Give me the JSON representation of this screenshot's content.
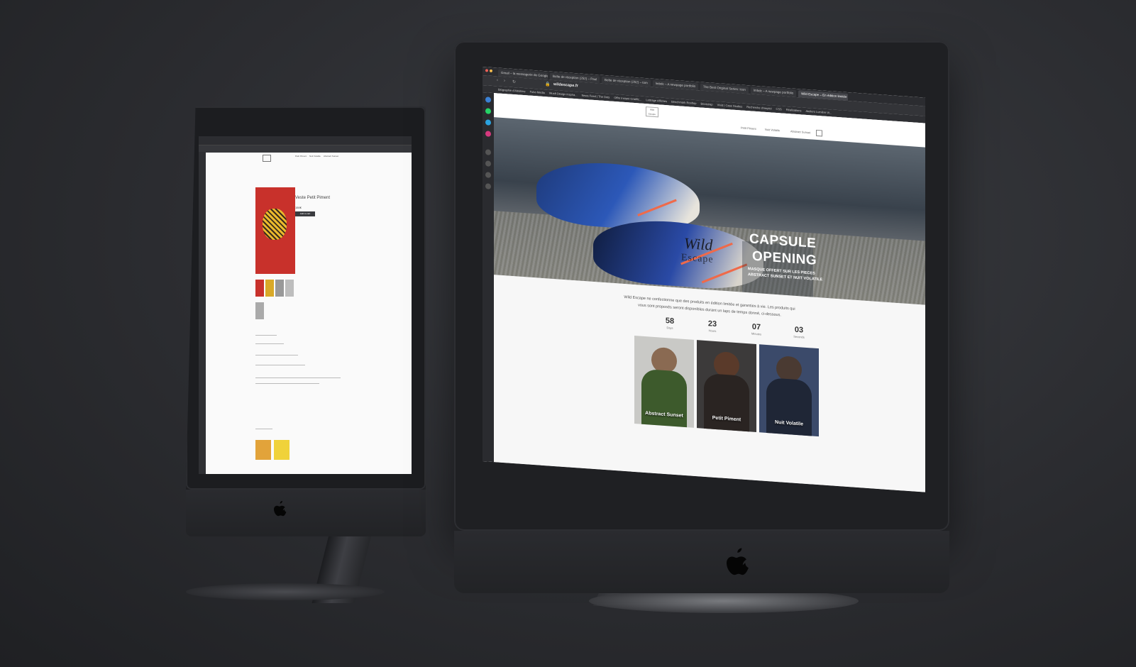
{
  "browser": {
    "tabs": [
      {
        "label": "Gmail – la messagerie de Google",
        "active": false
      },
      {
        "label": "Boîte de réception (252) – Paul",
        "active": false
      },
      {
        "label": "Boîte de réception (252) – tom",
        "active": false
      },
      {
        "label": "lmbdc – A newpage portfolio",
        "active": false
      },
      {
        "label": "The Best Original Series: Icon",
        "active": false
      },
      {
        "label": "lmbdc – A newpage portfolio",
        "active": false
      },
      {
        "label": "Wild Escape – En édition limitée",
        "active": true
      }
    ],
    "url": "wildescape.fr",
    "bookmarks": [
      "Biographie d'Alekhine",
      "Fubo Media",
      "Wusft Design inspira...",
      "News Feed | The Dots",
      "Offre Instant Gratific...",
      "Lettrage Affiches",
      "Benchmark Rooftop",
      "Bootstrap",
      "Vivid | Case Studies",
      "Recherche d'emploi",
      "CSS",
      "Réalisations",
      "Ateliers Lumière Vi..."
    ]
  },
  "site": {
    "logo_text": "Wild Escape",
    "nav": [
      "Petit Piment",
      "Nuit Volatile",
      "Abstract Sunset"
    ],
    "hero": {
      "wild": "Wild",
      "escape": "Escape",
      "title_line1": "CAPSULE",
      "title_line2": "OPENING",
      "sub_line1": "MASQUE OFFERT SUR LES PIECES",
      "sub_line2": "ABSTRACT SUNSET ET NUIT VOLATILE"
    },
    "intro_line1": "Wild Escape ne confectionne que des produits en édition limitée et garanties à vie. Les produits qui",
    "intro_line2": "vous sont proposés seront disponibles durant un laps de temps donné, ci-dessous.",
    "countdown": [
      {
        "value": "58",
        "label": "Days"
      },
      {
        "value": "23",
        "label": "Hours"
      },
      {
        "value": "07",
        "label": "Minutes"
      },
      {
        "value": "03",
        "label": "Seconds"
      }
    ],
    "products": [
      {
        "name": "Abstract Sunset"
      },
      {
        "name": "Petit Piment"
      },
      {
        "name": "Nuit Volatile"
      }
    ]
  },
  "product_page": {
    "title": "Veste Petit Piment",
    "price": "150€",
    "add_button": "Add to cart"
  },
  "colors": {
    "accent_orange": "#ef6a4a",
    "product_red": "#c8312b",
    "product_yellow": "#e9b82c",
    "bezel": "#1f2023"
  }
}
